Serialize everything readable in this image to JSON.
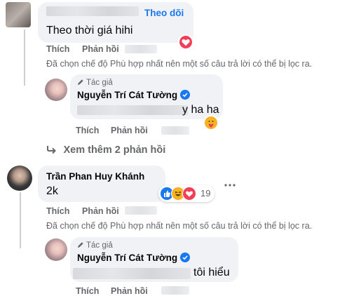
{
  "comment1": {
    "follow_label": "Theo dõi",
    "text": "Theo thời giá hihi",
    "actions": {
      "like": "Thích",
      "reply": "Phản hồi"
    }
  },
  "filter_notice": "Đã chọn chế độ Phù hợp nhất nên một số câu trả lời có thể bị lọc ra.",
  "reply1": {
    "badge": "Tác giả",
    "name": "Nguyễn Trí Cát Tường",
    "text_visible": "y ha ha",
    "actions": {
      "like": "Thích",
      "reply": "Phản hồi"
    }
  },
  "more_replies": "Xem thêm 2 phản hồi",
  "comment2": {
    "name": "Trần Phan Huy Khánh",
    "text": "2k",
    "reaction_count": "19",
    "actions": {
      "like": "Thích",
      "reply": "Phản hồi"
    }
  },
  "reply2": {
    "badge": "Tác giả",
    "name": "Nguyễn Trí Cát Tường",
    "text_visible": "tôi hiểu",
    "actions": {
      "like": "Thích",
      "reply": "Phản hồi"
    }
  },
  "colors": {
    "link_blue": "#1877f2",
    "bubble_bg": "#f0f2f5",
    "secondary_text": "#65676b",
    "love_red": "#f33e58",
    "haha_yellow": "#f7b125"
  },
  "icons": [
    "heart-reaction-icon",
    "care-reaction-icon",
    "like-reaction-icon",
    "haha-reaction-icon",
    "pencil-icon",
    "verified-icon",
    "reply-arrow-icon",
    "more-options-icon"
  ]
}
